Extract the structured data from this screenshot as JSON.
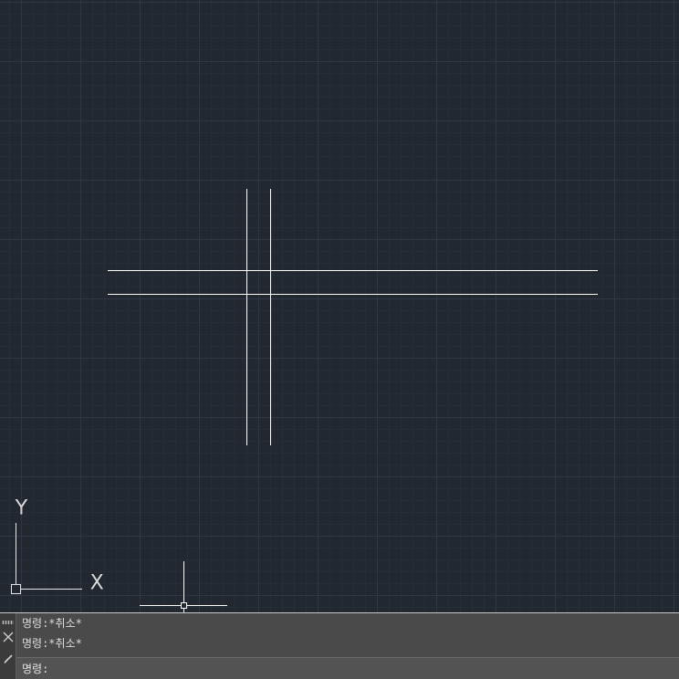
{
  "colors": {
    "canvas_background": "#212830",
    "grid_major": "#2f3744",
    "grid_minor": "#262d38",
    "entity_stroke": "#ffffff",
    "command_bar_background": "#4a4a4a"
  },
  "ucs": {
    "x_label": "X",
    "y_label": "Y"
  },
  "command_line": {
    "history": [
      "명령:*취소*",
      "명령:*취소*"
    ],
    "prompt": "명령:",
    "input_value": "",
    "icons": {
      "grip": "grip-icon",
      "close": "close-icon",
      "customize": "customize-icon"
    }
  }
}
